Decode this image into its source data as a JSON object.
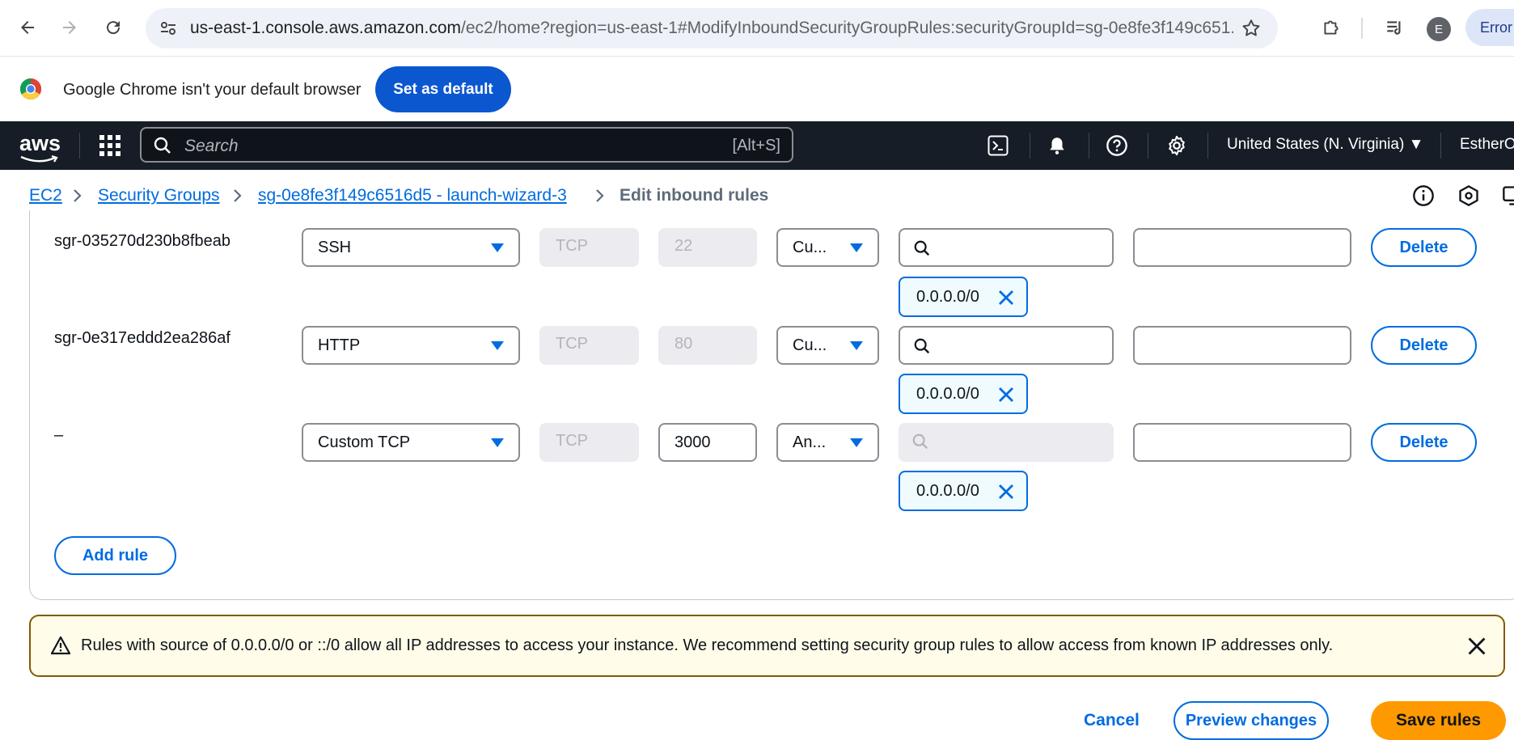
{
  "browser": {
    "url_host": "us-east-1.console.aws.amazon.com",
    "url_path": "/ec2/home?region=us-east-1#ModifyInboundSecurityGroupRules:securityGroupId=sg-0e8fe3f149c651...",
    "avatar_letter": "E",
    "error_label": "Error"
  },
  "infobar": {
    "message": "Google Chrome isn't your default browser",
    "button": "Set as default"
  },
  "aws_nav": {
    "logo": "aws",
    "search_placeholder": "Search",
    "search_shortcut": "[Alt+S]",
    "region": "United States (N. Virginia) ▼",
    "account": "EstherO"
  },
  "breadcrumb": {
    "items": [
      "EC2",
      "Security Groups",
      "sg-0e8fe3f149c6516d5 - launch-wizard-3"
    ],
    "current": "Edit inbound rules"
  },
  "rules": [
    {
      "id": "sgr-035270d230b8fbeab",
      "type": "SSH",
      "protocol": "TCP",
      "port": "22",
      "source_type": "Cu...",
      "cidr": "0.0.0.0/0",
      "delete": "Delete"
    },
    {
      "id": "sgr-0e317eddd2ea286af",
      "type": "HTTP",
      "protocol": "TCP",
      "port": "80",
      "source_type": "Cu...",
      "cidr": "0.0.0.0/0",
      "delete": "Delete"
    },
    {
      "id": "–",
      "type": "Custom TCP",
      "protocol": "TCP",
      "port": "3000",
      "source_type": "An...",
      "cidr": "0.0.0.0/0",
      "delete": "Delete"
    }
  ],
  "add_rule": "Add rule",
  "alert": {
    "message": "Rules with source of 0.0.0.0/0 or ::/0 allow all IP addresses to access your instance. We recommend setting security group rules to allow access from known IP addresses only."
  },
  "footer": {
    "cancel": "Cancel",
    "preview": "Preview changes",
    "save": "Save rules"
  },
  "colors": {
    "aws_nav_bg": "#161d26",
    "link_blue": "#006ce0",
    "primary_orange": "#ff9900",
    "warning_border": "#855900"
  }
}
